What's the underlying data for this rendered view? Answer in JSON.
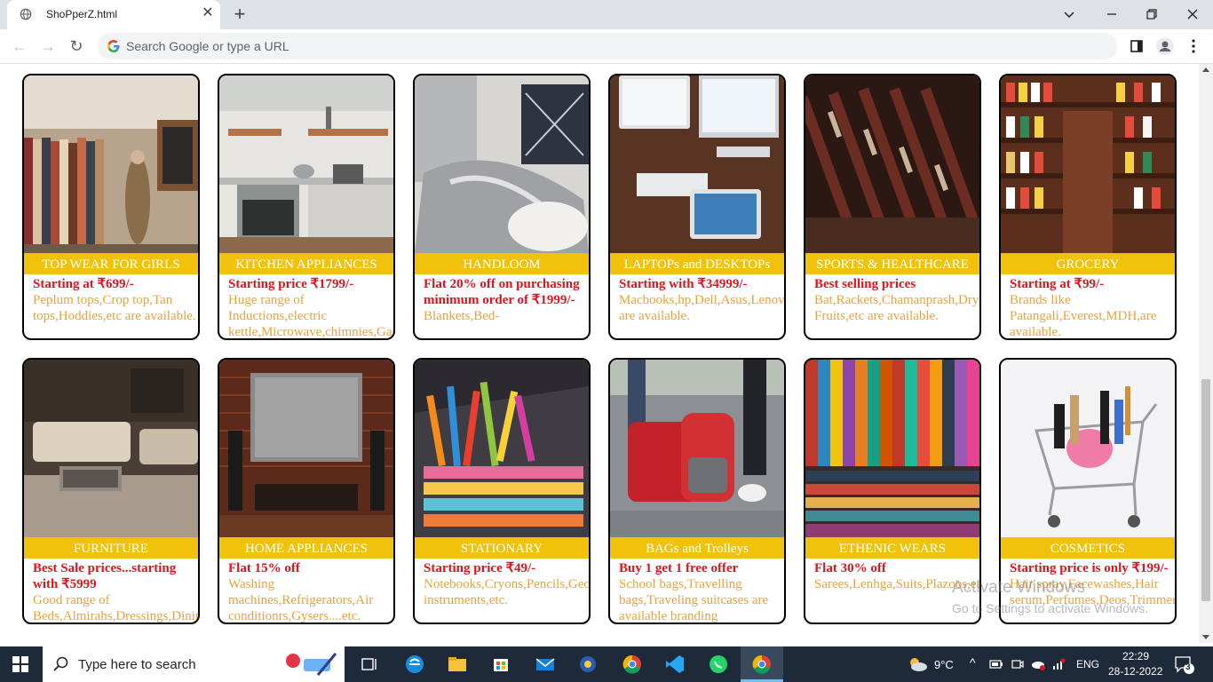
{
  "browser": {
    "tab_title": "ShoPperZ.html",
    "omnibox_placeholder": "Search Google or type a URL"
  },
  "products": [
    {
      "title": "TOP WEAR FOR GIRLS",
      "offer": "Starting at ₹699/-",
      "desc": "Peplum tops,Crop top,Tan tops,Hoddies,etc are available."
    },
    {
      "title": "KITCHEN APPLIANCES",
      "offer": "Starting price ₹1799/-",
      "desc": "Huge range of Inductions,electric kettle,Microwave,chimnies,Gas stoves,etc."
    },
    {
      "title": "HANDLOOM",
      "offer": "Flat 20% off on purchasing minimum order of ₹1999/-",
      "desc": "Blankets,Bed-"
    },
    {
      "title": "LAPTOPs and DESKTOPs",
      "offer": "Starting with ₹34999/-",
      "desc": "Macbooks,hp,Dell,Asus,Lenovo,etc are available."
    },
    {
      "title": "SPORTS & HEALTHCARE",
      "offer": "Best selling prices",
      "desc": "Bat,Rackets,Chamanprash,Dry Fruits,etc are available."
    },
    {
      "title": "GROCERY",
      "offer": "Starting at ₹99/-",
      "desc": "Brands like Patangali,Everest,MDH,are available."
    },
    {
      "title": "FURNITURE",
      "offer": "Best Sale prices...starting with ₹5999",
      "desc": "Good range of Beds,Almirahs,Dressings,Dining tables,etc."
    },
    {
      "title": "HOME APPLIANCES",
      "offer": "Flat 15% off",
      "desc": "Washing machines,Refrigerators,Air conditionrs,Gysers....etc."
    },
    {
      "title": "STATIONARY",
      "offer": "Starting price ₹49/-",
      "desc": "Notebooks,Cryons,Pencils,Geometry instruments,etc."
    },
    {
      "title": "BAGs and Trolleys",
      "offer": "Buy 1 get 1 free offer",
      "desc": "School bags,Travelling bags,Traveling suitcases are available branding"
    },
    {
      "title": "ETHENIC WEARS",
      "offer": "Flat 30% off",
      "desc": "Sarees,Lenhga,Suits,Plazoos,etc."
    },
    {
      "title": "COSMETICS",
      "offer": "Starting price is only ₹199/-",
      "desc": "Hair spray,Facewashes,Hair serum,Perfumes,Deos,Trimmers"
    }
  ],
  "watermark": {
    "line1": "Activate Windows",
    "line2": "Go to Settings to activate Windows."
  },
  "taskbar": {
    "search_placeholder": "Type here to search",
    "weather": "9°C",
    "language": "ENG",
    "time": "22:29",
    "date": "28-12-2022",
    "notification_count": "3"
  }
}
